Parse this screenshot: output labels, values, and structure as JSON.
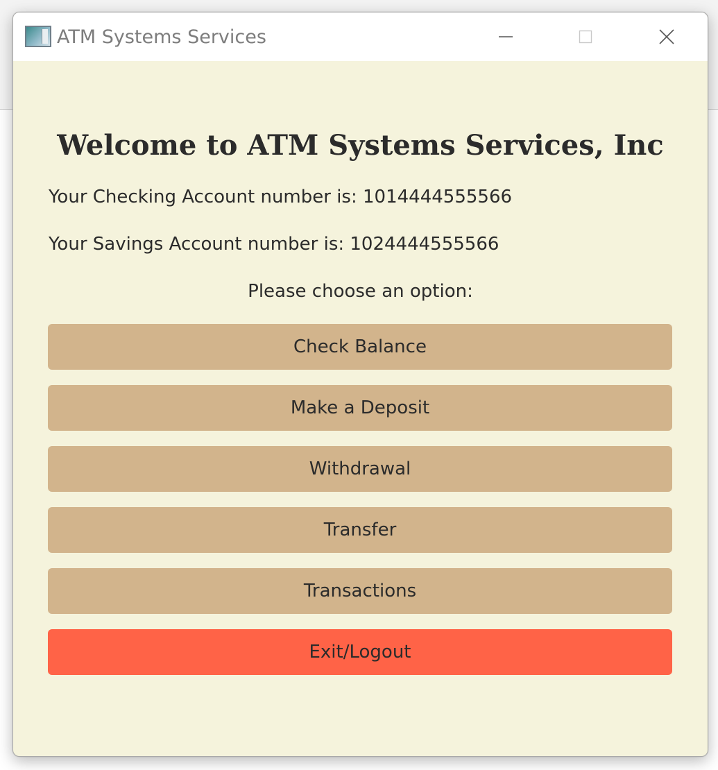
{
  "window": {
    "title": "ATM Systems Services"
  },
  "main": {
    "heading": "Welcome to ATM Systems Services, Inc",
    "checking_text": "Your Checking Account number is: 1014444555566",
    "savings_text": "Your Savings Account number is: 1024444555566",
    "prompt": "Please choose an option:"
  },
  "buttons": {
    "check_balance": "Check Balance",
    "deposit": "Make a Deposit",
    "withdrawal": "Withdrawal",
    "transfer": "Transfer",
    "transactions": "Transactions",
    "exit": "Exit/Logout"
  },
  "colors": {
    "window_background": "#f5f3dc",
    "option_button": "#d2b48c",
    "exit_button": "#ff6347"
  },
  "icons": {
    "app": "atm-app-icon",
    "minimize": "minimize-icon",
    "maximize": "maximize-icon",
    "close": "close-icon"
  }
}
